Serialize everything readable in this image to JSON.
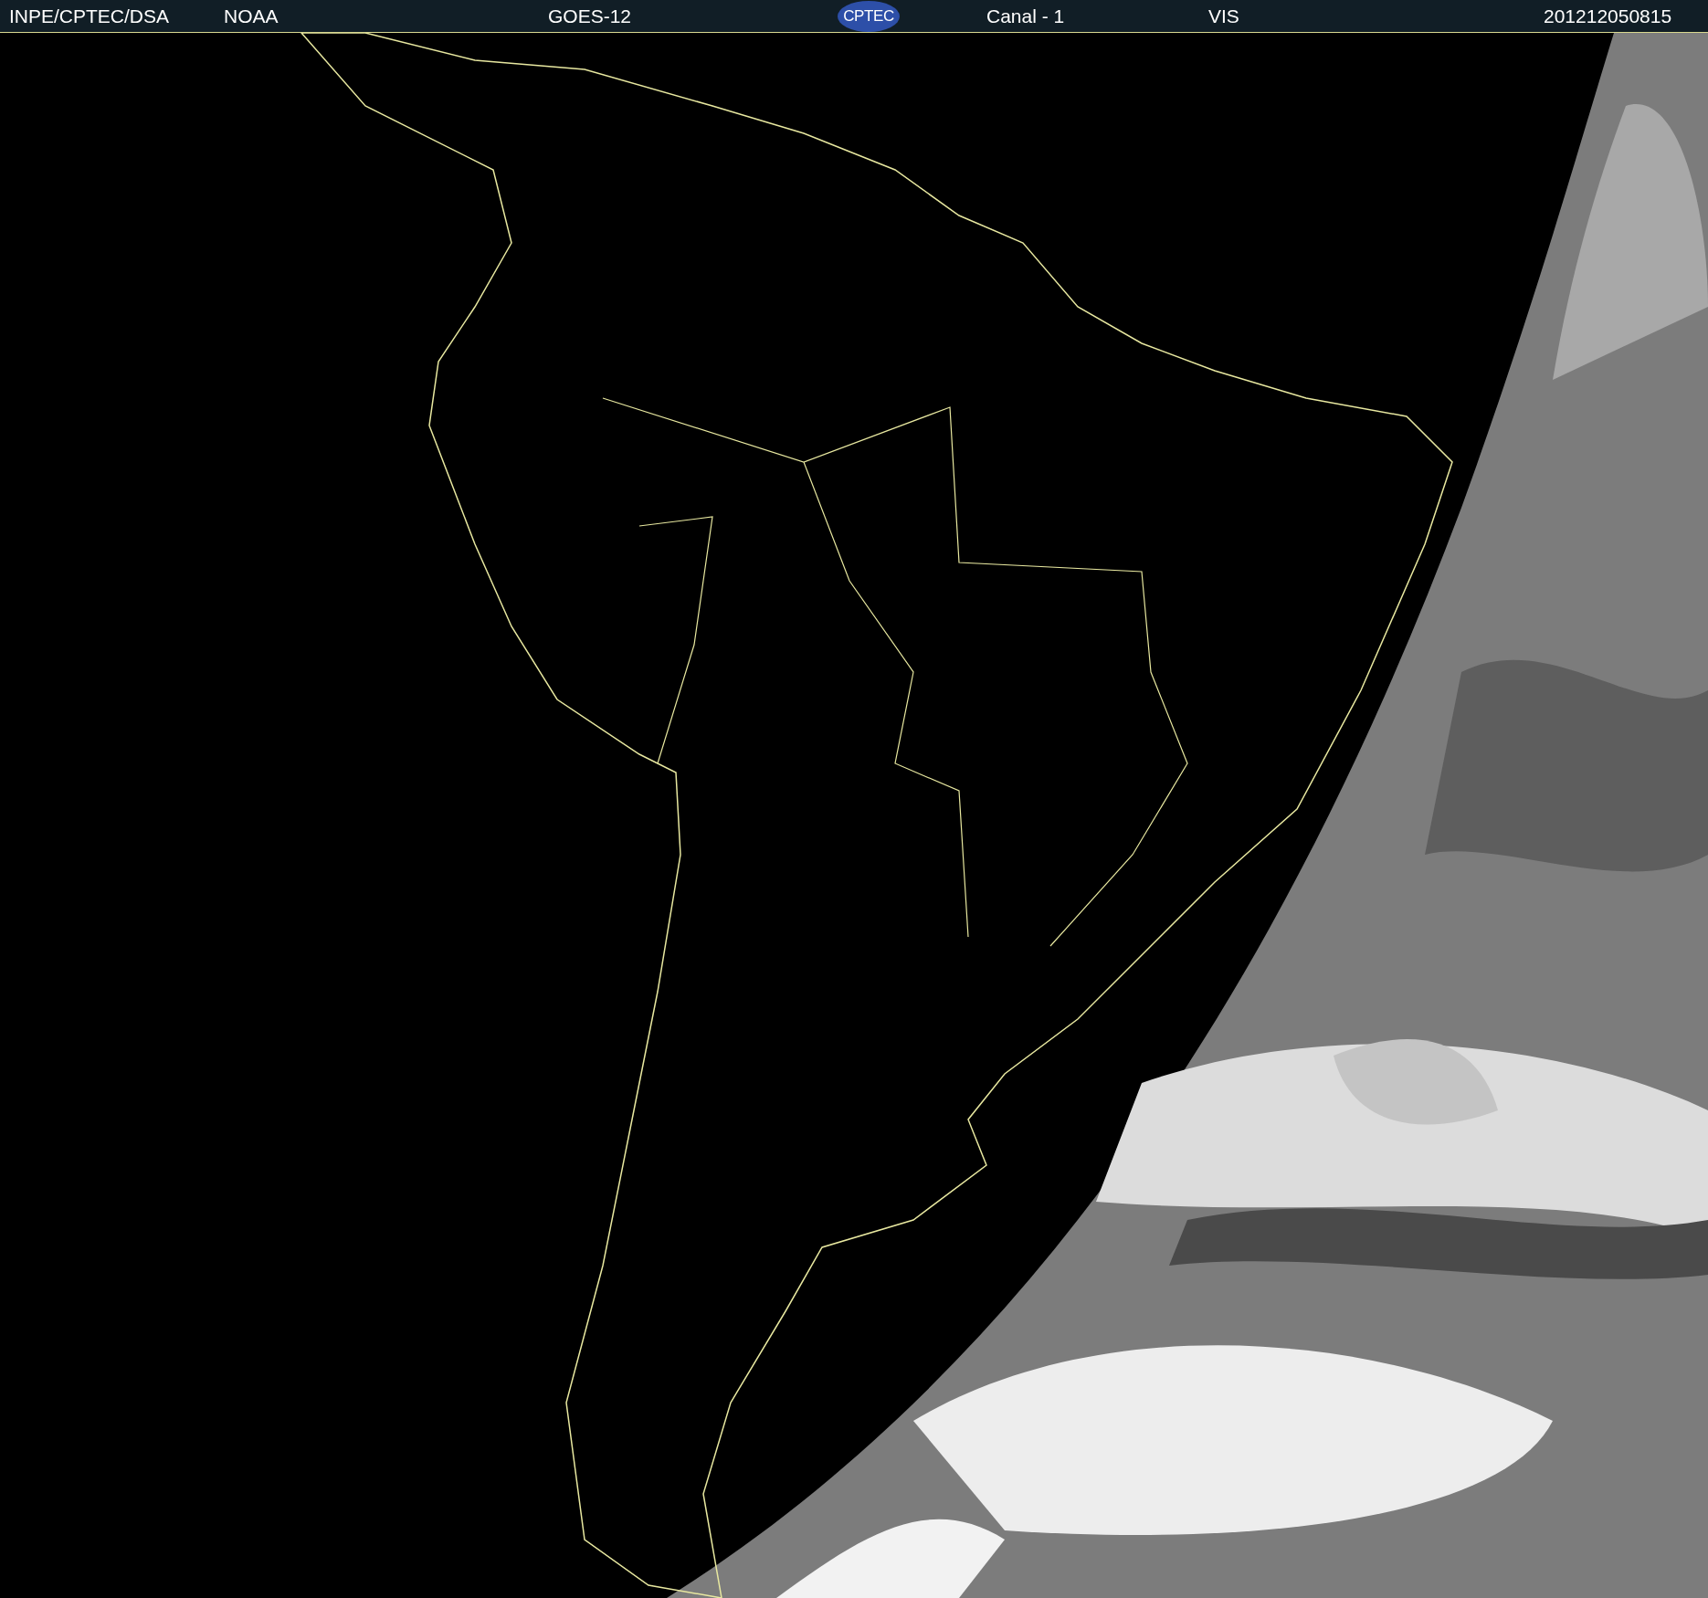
{
  "header": {
    "source": "INPE/CPTEC/DSA",
    "agency": "NOAA",
    "satellite": "GOES-12",
    "logo": "CPTEC",
    "channel": "Canal - 1",
    "band": "VIS",
    "timestamp": "201212050815"
  }
}
